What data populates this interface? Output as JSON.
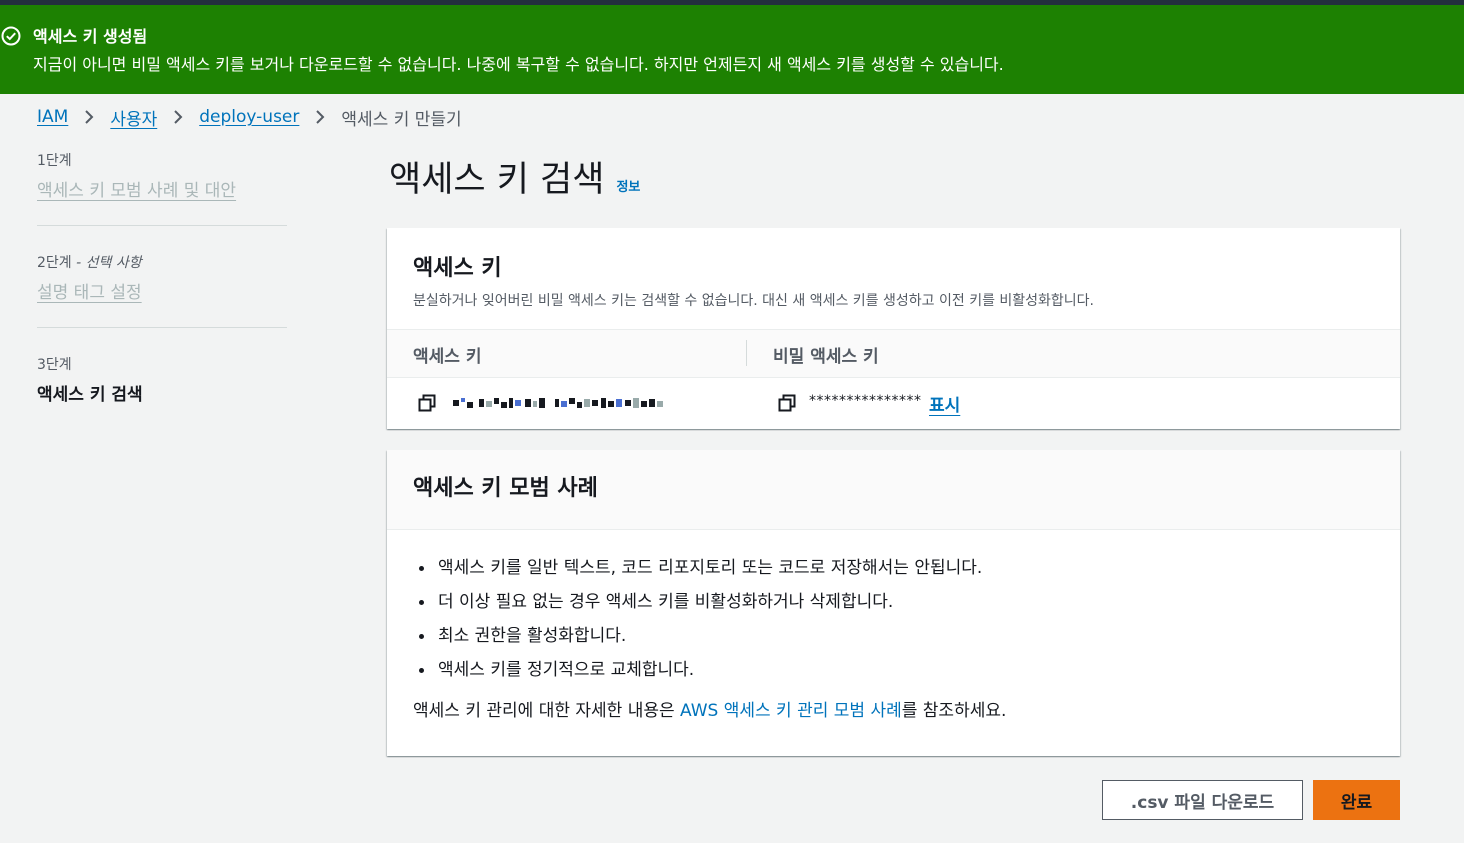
{
  "flash": {
    "title": "액세스 키 생성됨",
    "message": "지금이 아니면 비밀 액세스 키를 보거나 다운로드할 수 없습니다. 나중에 복구할 수 없습니다. 하지만 언제든지 새 액세스 키를 생성할 수 있습니다.",
    "color": "#1d8102"
  },
  "breadcrumb": {
    "items": [
      "IAM",
      "사용자",
      "deploy-user"
    ],
    "current": "액세스 키 만들기"
  },
  "steps": [
    {
      "label": "1단계",
      "title": "액세스 키 모범 사례 및 대안"
    },
    {
      "label": "2단계",
      "optional": "- 선택 사항",
      "title": "설명 태그 설정"
    },
    {
      "label": "3단계",
      "title": "액세스 키 검색"
    }
  ],
  "page": {
    "title": "액세스 키 검색",
    "info": "정보"
  },
  "access_key_card": {
    "title": "액세스 키",
    "description": "분실하거나 잊어버린 비밀 액세스 키는 검색할 수 없습니다. 대신 새 액세스 키를 생성하고 이전 키를 비활성화합니다.",
    "col_access_key": "액세스 키",
    "col_secret_key": "비밀 액세스 키",
    "secret_masked": "***************",
    "show_label": "표시"
  },
  "best_practices": {
    "title": "액세스 키 모범 사례",
    "items": [
      "액세스 키를 일반 텍스트, 코드 리포지토리 또는 코드로 저장해서는 안됩니다.",
      "더 이상 필요 없는 경우 액세스 키를 비활성화하거나 삭제합니다.",
      "최소 권한을 활성화합니다.",
      "액세스 키를 정기적으로 교체합니다."
    ],
    "ref_prefix": "액세스 키 관리에 대한 자세한 내용은 ",
    "ref_link": "AWS 액세스 키 관리 모범 사례",
    "ref_suffix": "를 참조하세요."
  },
  "buttons": {
    "download_csv": ".csv 파일 다운로드",
    "done": "완료"
  },
  "colors": {
    "link": "#0073bb",
    "primary": "#ec7211"
  }
}
